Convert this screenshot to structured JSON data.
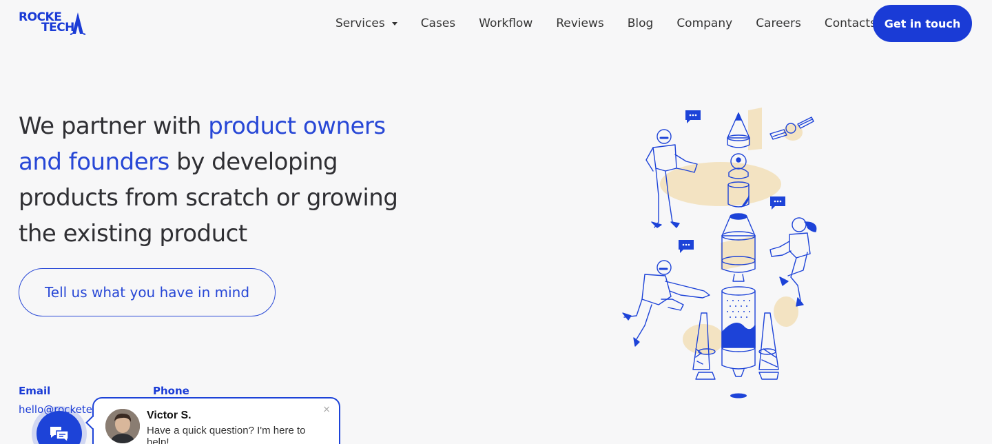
{
  "brand": {
    "line1": "ROCKE",
    "line2": "TECH"
  },
  "nav": {
    "items": [
      {
        "label": "Services",
        "has_dropdown": true
      },
      {
        "label": "Cases"
      },
      {
        "label": "Workflow"
      },
      {
        "label": "Reviews"
      },
      {
        "label": "Blog"
      },
      {
        "label": "Company"
      },
      {
        "label": "Careers"
      },
      {
        "label": "Contacts"
      }
    ],
    "cta": "Get in touch"
  },
  "hero": {
    "text_before": "We partner with ",
    "text_accent": "product owners and founders",
    "text_after": " by developing products from scratch or growing the existing product",
    "cta": "Tell us what you have in mind"
  },
  "contacts": {
    "email_label": "Email",
    "email_value": "hello@rocketech",
    "phone_label": "Phone"
  },
  "chat": {
    "agent_name": "Victor S.",
    "message": "Have a quick question? I'm here to help!",
    "close_icon": "×"
  },
  "colors": {
    "brand_blue": "#1a3bd6",
    "accent_blue": "#2747d6",
    "background": "#f7f7f8",
    "illustration_sand": "#f3e3c2"
  }
}
